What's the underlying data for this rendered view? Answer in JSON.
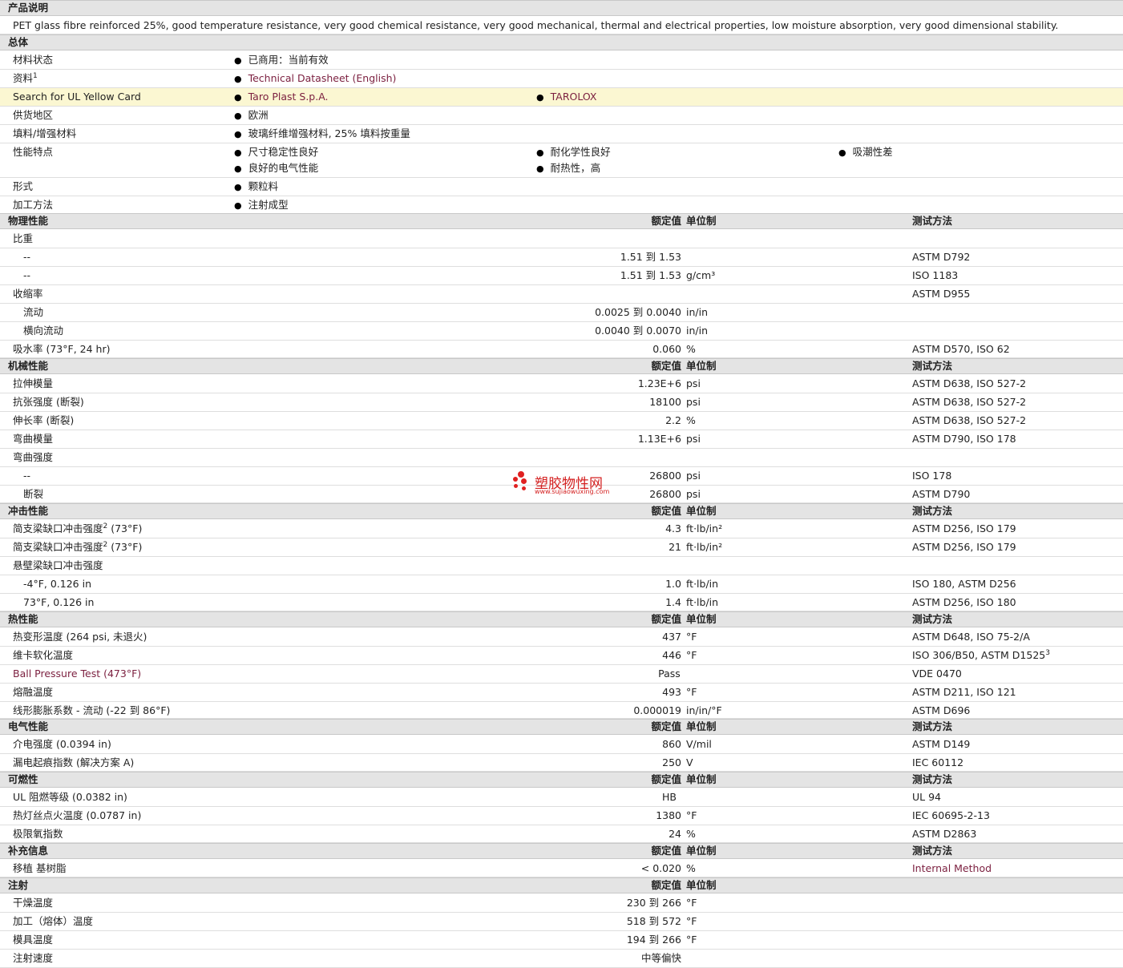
{
  "product": {
    "heading": "产品说明",
    "description": "PET glass fibre reinforced 25%, good temperature resistance, very good chemical resistance, very good mechanical, thermal and electrical properties, low moisture absorption, very good dimensional stability."
  },
  "general": {
    "heading": "总体",
    "rows": [
      {
        "label": "材料状态",
        "values": [
          "已商用：当前有效"
        ]
      },
      {
        "label": "资料",
        "sup": "1",
        "values": [
          "Technical Datasheet (English)"
        ]
      },
      {
        "label": "Search for UL Yellow Card",
        "values": [
          "Taro Plast S.p.A.",
          "TAROLOX"
        ]
      },
      {
        "label": "供货地区",
        "values": [
          "欧洲"
        ]
      },
      {
        "label": "填料/增强材料",
        "values": [
          "玻璃纤维增强材料, 25% 填料按重量"
        ]
      },
      {
        "label": "性能特点",
        "values": [
          "尺寸稳定性良好",
          "耐化学性良好",
          "吸潮性差",
          "良好的电气性能",
          "耐热性，高"
        ]
      },
      {
        "label": "形式",
        "values": [
          "颗粒料"
        ]
      },
      {
        "label": "加工方法",
        "values": [
          "注射成型"
        ]
      }
    ]
  },
  "columns": {
    "nominal": "额定值",
    "unit": "单位制",
    "test": "测试方法"
  },
  "sections": [
    {
      "title": "物理性能",
      "rows": [
        {
          "label": "比重",
          "value": "",
          "unit": "",
          "method": ""
        },
        {
          "label": "--",
          "indent": true,
          "value": "1.51 到  1.53",
          "unit": "",
          "method": "ASTM D792"
        },
        {
          "label": "--",
          "indent": true,
          "value": "1.51 到  1.53",
          "unit": "g/cm³",
          "method": "ISO 1183"
        },
        {
          "label": "收缩率",
          "value": "",
          "unit": "",
          "method": "ASTM D955"
        },
        {
          "label": "流动",
          "indent": true,
          "value": "0.0025 到  0.0040",
          "unit": "in/in",
          "method": ""
        },
        {
          "label": "横向流动",
          "indent": true,
          "value": "0.0040 到  0.0070",
          "unit": "in/in",
          "method": ""
        },
        {
          "label": "吸水率  (73°F, 24 hr)",
          "value": "0.060",
          "unit": "%",
          "method": "ASTM D570, ISO 62"
        }
      ]
    },
    {
      "title": "机械性能",
      "rows": [
        {
          "label": "拉伸模量",
          "value": "1.23E+6",
          "unit": "psi",
          "method": "ASTM D638, ISO 527-2"
        },
        {
          "label": "抗张强度  (断裂)",
          "value": "18100",
          "unit": "psi",
          "method": "ASTM D638, ISO 527-2"
        },
        {
          "label": "伸长率  (断裂)",
          "value": "2.2",
          "unit": "%",
          "method": "ASTM D638, ISO 527-2"
        },
        {
          "label": "弯曲模量",
          "value": "1.13E+6",
          "unit": "psi",
          "method": "ASTM D790, ISO 178"
        },
        {
          "label": "弯曲强度",
          "value": "",
          "unit": "",
          "method": ""
        },
        {
          "label": "--",
          "indent": true,
          "value": "26800",
          "unit": "psi",
          "method": "ISO 178"
        },
        {
          "label": "断裂",
          "indent": true,
          "value": "26800",
          "unit": "psi",
          "method": "ASTM D790"
        }
      ]
    },
    {
      "title": "冲击性能",
      "rows": [
        {
          "label": "简支梁缺口冲击强度",
          "sup": "2",
          "suffix": " (73°F)",
          "value": "4.3",
          "unit": "ft·lb/in²",
          "method": "ASTM D256, ISO 179"
        },
        {
          "label": "简支梁缺口冲击强度",
          "sup": "2",
          "suffix": " (73°F)",
          "value": "21",
          "unit": "ft·lb/in²",
          "method": "ASTM D256, ISO 179"
        },
        {
          "label": "悬壁梁缺口冲击强度",
          "value": "",
          "unit": "",
          "method": ""
        },
        {
          "label": "-4°F, 0.126 in",
          "indent": true,
          "value": "1.0",
          "unit": "ft·lb/in",
          "method": "ISO 180, ASTM D256"
        },
        {
          "label": "73°F, 0.126 in",
          "indent": true,
          "value": "1.4",
          "unit": "ft·lb/in",
          "method": "ASTM D256, ISO 180"
        }
      ]
    },
    {
      "title": "热性能",
      "rows": [
        {
          "label": "热变形温度  (264 psi, 未退火)",
          "value": "437",
          "unit": "°F",
          "method": "ASTM D648, ISO 75-2/A"
        },
        {
          "label": "维卡软化温度",
          "value": "446",
          "unit": "°F",
          "method": "ISO 306/B50, ASTM D1525",
          "method_sup": "3"
        },
        {
          "label": "Ball Pressure Test (473°F)",
          "link": true,
          "value": "Pass",
          "value_center": true,
          "unit": "",
          "method": "VDE 0470"
        },
        {
          "label": "熔融温度",
          "value": "493",
          "unit": "°F",
          "method": "ASTM D211, ISO 121"
        },
        {
          "label": "线形膨胀系数  - 流动  (-22 到  86°F)",
          "value": "0.000019",
          "unit": "in/in/°F",
          "method": "ASTM D696"
        }
      ]
    },
    {
      "title": "电气性能",
      "rows": [
        {
          "label": "介电强度  (0.0394 in)",
          "value": "860",
          "unit": "V/mil",
          "method": "ASTM D149"
        },
        {
          "label": "漏电起痕指数  (解决方案  A)",
          "value": "250",
          "unit": "V",
          "method": "IEC 60112"
        }
      ]
    },
    {
      "title": "可燃性",
      "rows": [
        {
          "label": "UL 阻燃等级  (0.0382 in)",
          "value": "HB",
          "value_center": true,
          "unit": "",
          "method": "UL 94"
        },
        {
          "label": "热灯丝点火温度  (0.0787 in)",
          "value": "1380",
          "unit": "°F",
          "method": "IEC 60695-2-13"
        },
        {
          "label": "极限氧指数",
          "value": "24",
          "unit": "%",
          "method": "ASTM D2863"
        }
      ]
    },
    {
      "title": "补充信息",
      "rows": [
        {
          "label": "移植  基树脂",
          "value": "< 0.020",
          "unit": "%",
          "method": "Internal Method",
          "method_link": true
        }
      ]
    },
    {
      "title": "注射",
      "no_test": true,
      "rows": [
        {
          "label": "干燥温度",
          "value": "230 到  266",
          "unit": "°F",
          "method": ""
        },
        {
          "label": "加工（熔体）温度",
          "value": "518 到  572",
          "unit": "°F",
          "method": ""
        },
        {
          "label": "模具温度",
          "value": "194 到  266",
          "unit": "°F",
          "method": ""
        },
        {
          "label": "注射速度",
          "value": "中等偏快",
          "unit": "",
          "method": ""
        }
      ]
    }
  ],
  "watermark": {
    "text": "塑胶物性网",
    "url": "www.sujiaowuxing.com"
  }
}
